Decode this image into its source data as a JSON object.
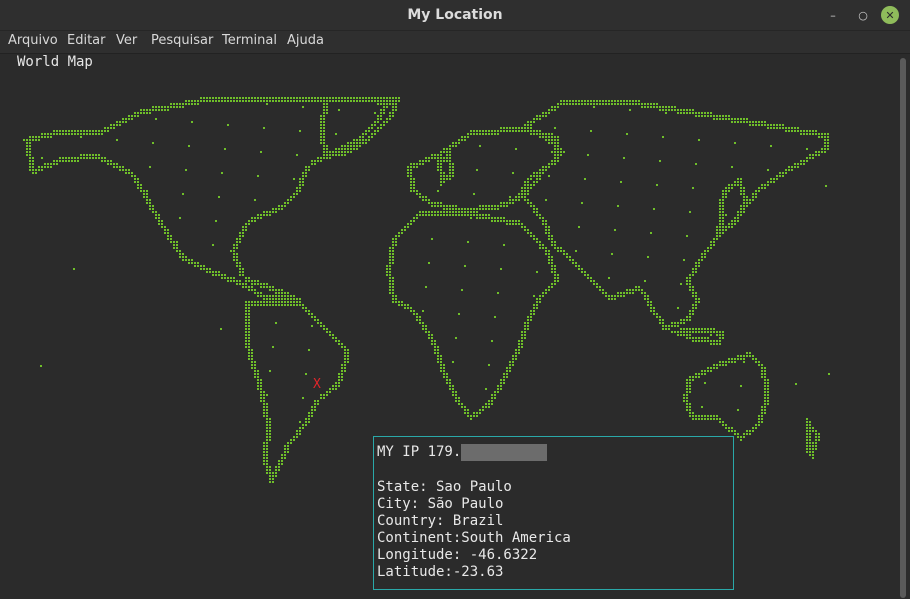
{
  "window": {
    "title": "My Location"
  },
  "menu": [
    "Arquivo",
    "Editar",
    "Ver",
    "Pesquisar",
    "Terminal",
    "Ajuda"
  ],
  "map": {
    "heading": "World Map",
    "dot_color": "#6fbf2a",
    "marker_label": "X",
    "marker_color": "#e0262b"
  },
  "info": {
    "ip_label": "MY IP 179.",
    "state": "State: Sao Paulo",
    "city": "City: São Paulo",
    "country": "Country: Brazil",
    "continent": "Continent:South America",
    "longitude": "Longitude: -46.6322",
    "latitude": "Latitude:-23.63",
    "border_color": "#2aa8a8"
  }
}
